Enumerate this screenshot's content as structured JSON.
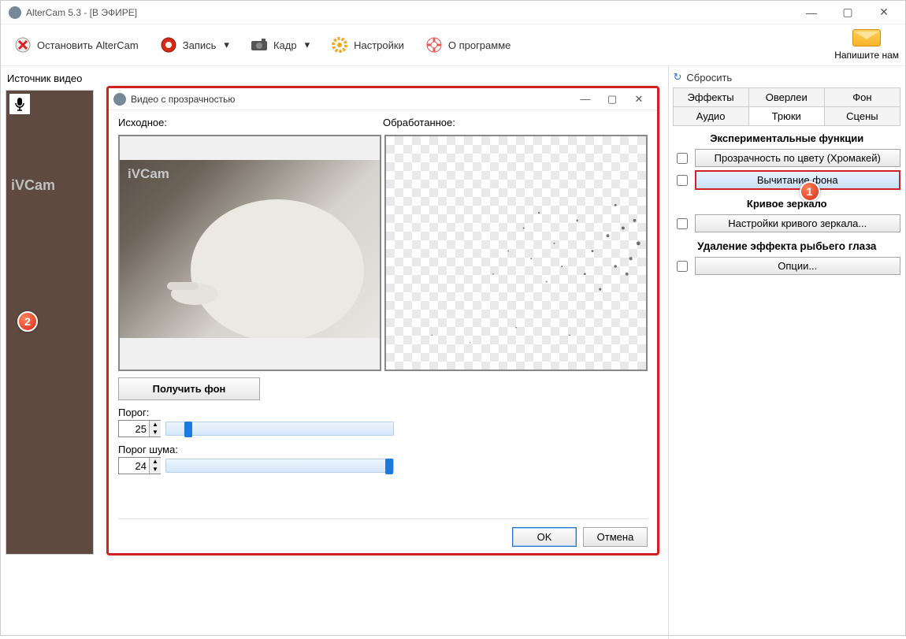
{
  "app": {
    "title": "AlterCam 5.3 - [В ЭФИРЕ]"
  },
  "toolbar": {
    "stop": "Остановить AlterCam",
    "record": "Запись",
    "frame": "Кадр",
    "settings": "Настройки",
    "about": "О программе",
    "write_us": "Напишите нам"
  },
  "left": {
    "source_label": "Источник видео",
    "ivcam": "iVCam"
  },
  "right": {
    "reset": "Сбросить",
    "tabs": {
      "effects": "Эффекты",
      "overlays": "Оверлеи",
      "bg": "Фон",
      "audio": "Аудио",
      "tricks": "Трюки",
      "scenes": "Сцены"
    },
    "section1": "Экспериментальные функции",
    "chromakey": "Прозрачность по цвету (Хромакей)",
    "bg_subtract": "Вычитание фона",
    "section2": "Кривое зеркало",
    "mirror_opts": "Настройки кривого зеркала...",
    "section3": "Удаление эффекта рыбьего глаза",
    "options": "Опции..."
  },
  "dialog": {
    "title": "Видео с прозрачностью",
    "src_label": "Исходное:",
    "proc_label": "Обработанное:",
    "ivcam": "iVCam",
    "get_bg": "Получить фон",
    "threshold_label": "Порог:",
    "threshold_value": "25",
    "noise_label": "Порог шума:",
    "noise_value": "24",
    "ok": "OK",
    "cancel": "Отмена"
  },
  "badges": {
    "b1": "1",
    "b2": "2"
  }
}
